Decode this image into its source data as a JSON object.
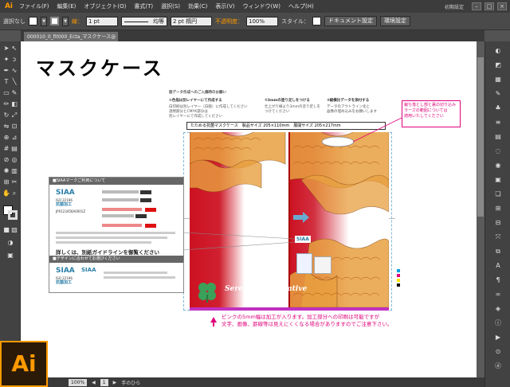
{
  "menubar": {
    "app_icon": "Ai",
    "items": [
      "ファイル(F)",
      "編集(E)",
      "オブジェクト(O)",
      "書式(T)",
      "選択(S)",
      "効果(C)",
      "表示(V)",
      "ウィンドウ(W)",
      "ヘルプ(H)"
    ],
    "workspace": "初期設定",
    "minimize": "–",
    "maximize": "□",
    "close": "×"
  },
  "control_bar": {
    "selection": "選択なし",
    "stroke_label": "線：",
    "stroke_weight": "1 pt",
    "profile_label": "均等",
    "brush_value": "2 pt 楕円",
    "opacity_label": "不透明度：",
    "opacity_value": "100%",
    "style_label": "スタイル：",
    "doc_setup_button": "ドキュメント設定",
    "preferences_button": "環境設定"
  },
  "document_tab": {
    "label": "000010_0_fit000_Ecta_マスクケース@ 100%"
  },
  "status_bar": {
    "zoom": "100%",
    "page": "1",
    "tool_name": "手のひら"
  },
  "splash": {
    "ai_logo": "Ai"
  },
  "artboard": {
    "title": "マスクケース",
    "intro_note": "版データ作成へのご入稿時のお願い",
    "step1_title": "①色指は別レイヤーにて作成する",
    "step1_body": [
      "白印刷は別レイヤー（白版）に作成してください",
      "透明部分とCMYK部分は",
      "別レイヤーにて作成してください"
    ],
    "step2_title": "②3mmの塗り足しをつける",
    "step2_body": [
      "仕上がり線より3mmの塗り足しを",
      "つけてください"
    ],
    "step3_title": "③縦横比データを添付する",
    "step3_body": [
      "データのアウトライン化と",
      "画像の埋め込みをお願いします"
    ],
    "pink_note": [
      "裁ち落とし部と裏の切り込み",
      "ラーズの範囲については",
      "適用いたしてください"
    ],
    "header_strip": "たためる抗菌マスクケース　製品サイズ 205×110mm　展開サイズ 205×217mm",
    "brand_text": "Serendipity Creative",
    "siaa_mini": "SIAA",
    "bottom_note": [
      "ピンクの5mm幅は加工が入ります。加工部分への印刷は可能ですが",
      "文字、画像、罫線等は見えにくくなる場合がありますのでご注意下さい。"
    ]
  },
  "siaa_guide": {
    "header1": "■SIAAマークご利用について",
    "logo": "SIAA",
    "iso": "ISO 22196",
    "antibacterial": "抗菌加工",
    "number": "JP0123456A0001Z",
    "notice": "詳しくは、別紙ガイドラインを御覧ください",
    "header2": "■デザインに合わせてお選びください",
    "logo2": "SIAA",
    "iso2": "ISO 22196",
    "antibacterial2": "抗菌加工"
  },
  "colors": {
    "accent_orange": "#ff9a00",
    "mask_red": "#cc1122",
    "pink_note": "#e0007a",
    "siaa_blue": "#2a7fa8"
  }
}
